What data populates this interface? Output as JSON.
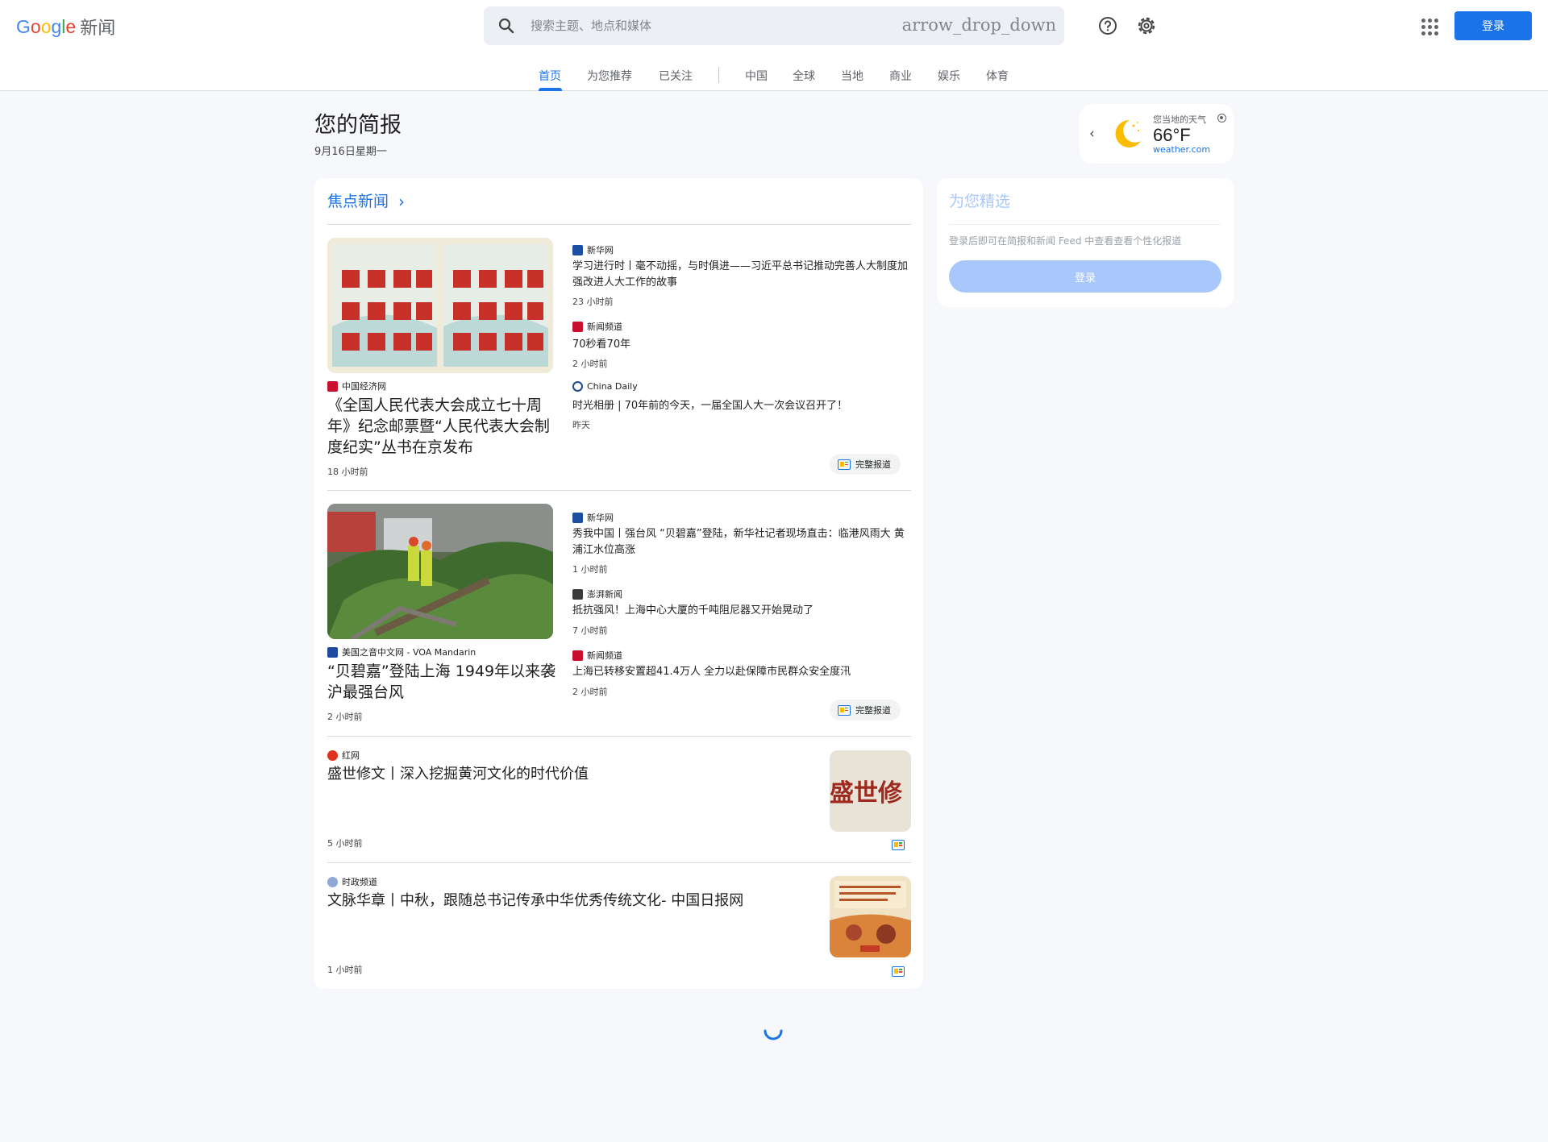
{
  "header": {
    "logo_word": "Google",
    "logo_suffix": "新闻",
    "search_placeholder": "搜索主题、地点和媒体",
    "search_dropdown_text": "arrow_drop_down",
    "login_label": "登录",
    "icons": [
      "search-icon",
      "help-icon",
      "settings-icon",
      "apps-icon"
    ]
  },
  "nav": {
    "tabs": [
      {
        "label": "首页",
        "active": true
      },
      {
        "label": "为您推荐"
      },
      {
        "label": "已关注"
      },
      {
        "label": "中国"
      },
      {
        "label": "全球"
      },
      {
        "label": "当地"
      },
      {
        "label": "商业"
      },
      {
        "label": "娱乐"
      },
      {
        "label": "体育"
      }
    ]
  },
  "page": {
    "title": "您的简报",
    "date": "9月16日星期一"
  },
  "weather": {
    "label": "您当地的天气",
    "temperature": "66°F",
    "source": "weather.com",
    "icon": "moon-icon"
  },
  "top_stories": {
    "title": "焦点新闻",
    "full_coverage_label": "完整报道",
    "clusters": [
      {
        "main": {
          "source": "中国经济网",
          "title": "《全国人民代表大会成立七十周年》纪念邮票暨“人民代表大会制度纪实”丛书在京发布",
          "time": "18 小时前"
        },
        "related": [
          {
            "source": "新华网",
            "title": "学习进行时丨毫不动摇，与时俱进——习近平总书记推动完善人大制度加强改进人大工作的故事",
            "time": "23 小时前"
          },
          {
            "source": "新闻频道",
            "title": "70秒看70年",
            "time": "2 小时前"
          },
          {
            "source": "China Daily",
            "title": "时光相册 | 70年前的今天，一届全国人大一次会议召开了！",
            "time": "昨天"
          }
        ]
      },
      {
        "main": {
          "source": "美国之音中文网 - VOA Mandarin",
          "title": "“贝碧嘉”登陆上海 1949年以来袭沪最强台风",
          "time": "2 小时前"
        },
        "related": [
          {
            "source": "新华网",
            "title": "秀我中国丨强台风 “贝碧嘉”登陆，新华社记者现场直击：临港风雨大 黄浦江水位高涨",
            "time": "1 小时前"
          },
          {
            "source": "澎湃新闻",
            "title": "抵抗强风！上海中心大厦的千吨阻尼器又开始晃动了",
            "time": "7 小时前"
          },
          {
            "source": "新闻频道",
            "title": "上海已转移安置超41.4万人 全力以赴保障市民群众安全度汛",
            "time": "2 小时前"
          }
        ]
      }
    ],
    "singles": [
      {
        "source": "红网",
        "title": "盛世修文丨深入挖掘黄河文化的时代价值",
        "time": "5 小时前",
        "thumb_text": "盛世修"
      },
      {
        "source": "时政频道",
        "title": "文脉华章丨中秋，跟随总书记传承中华优秀传统文化- 中国日报网",
        "time": "1 小时前"
      }
    ]
  },
  "picks": {
    "title": "为您精选",
    "description": "登录后即可在简报和新闻 Feed 中查看查看个性化报道",
    "button": "登录"
  },
  "colors": {
    "accent": "#1a73e8",
    "page_bg": "#f6f8fc",
    "disabled_button": "#a8c7fa"
  }
}
